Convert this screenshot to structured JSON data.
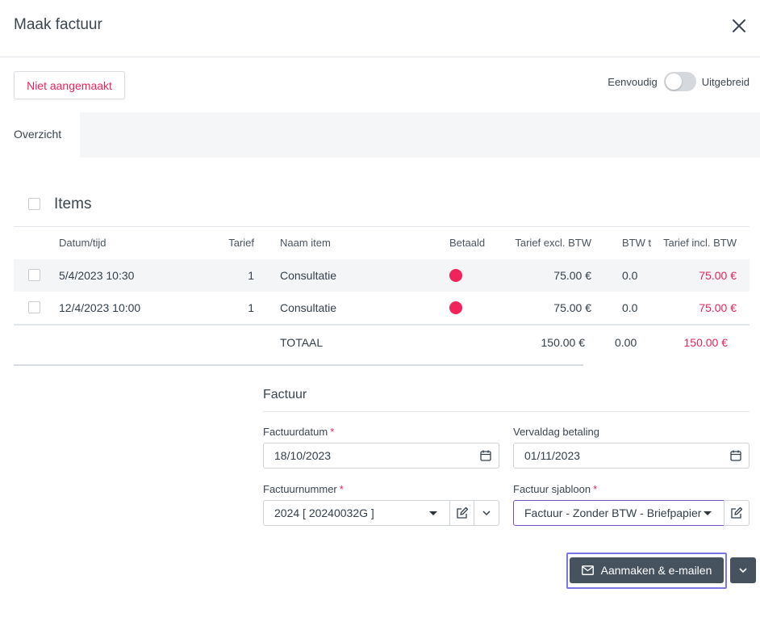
{
  "header": {
    "title": "Maak factuur"
  },
  "status": {
    "label": "Niet aangemaakt"
  },
  "mode": {
    "left_label": "Eenvoudig",
    "right_label": "Uitgebreid"
  },
  "tabs": [
    {
      "label": "Overzicht"
    }
  ],
  "items": {
    "title": "Items",
    "columns": {
      "date": "Datum/tijd",
      "rate": "Tarief",
      "name": "Naam item",
      "paid": "Betaald",
      "excl": "Tarief excl. BTW",
      "btw": "BTW t",
      "incl": "Tarief incl. BTW"
    },
    "rows": [
      {
        "date": "5/4/2023 10:30",
        "rate": "1",
        "name": "Consultatie",
        "paid_color": "#f0245a",
        "excl": "75.00 €",
        "btw": "0.0",
        "incl": "75.00 €"
      },
      {
        "date": "12/4/2023 10:00",
        "rate": "1",
        "name": "Consultatie",
        "paid_color": "#f0245a",
        "excl": "75.00 €",
        "btw": "0.0",
        "incl": "75.00 €"
      }
    ],
    "total": {
      "label": "TOTAAL",
      "excl": "150.00 €",
      "btw": "0.00",
      "incl": "150.00 €"
    }
  },
  "invoice": {
    "title": "Factuur",
    "date_label": "Factuurdatum",
    "date_value": "18/10/2023",
    "due_label": "Vervaldag betaling",
    "due_value": "01/11/2023",
    "number_label": "Factuurnummer",
    "number_value": "2024 [ 20240032G ]",
    "template_label": "Factuur sjabloon",
    "template_value": "Factuur - Zonder BTW - Briefpapier",
    "required_mark": "*"
  },
  "actions": {
    "primary_label": "Aanmaken & e-mailen"
  },
  "colors": {
    "accent": "#e8245b",
    "primary_button": "#46525d",
    "focus": "#7b76e8"
  }
}
